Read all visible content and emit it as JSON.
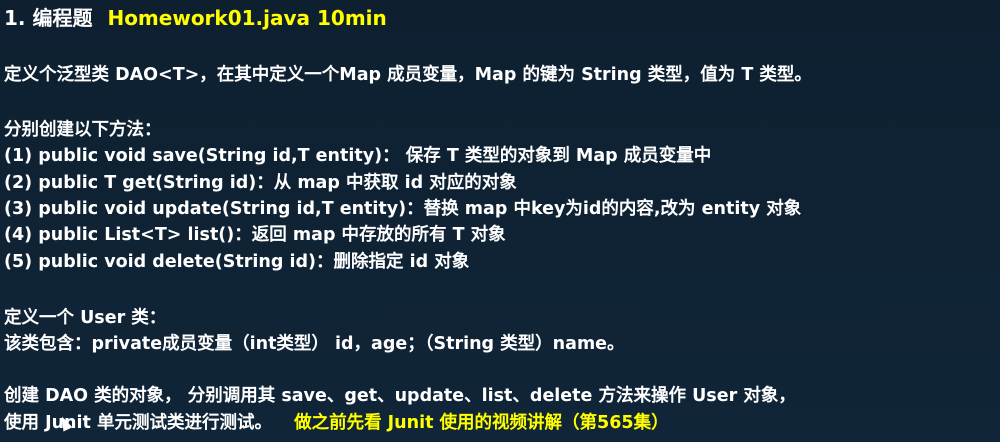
{
  "title": {
    "number": "1. 编程题",
    "file": "Homework01.java  10min"
  },
  "task_intro": "定义个泛型类 DAO<T>，在其中定义一个Map 成员变量，Map 的键为 String 类型，值为 T 类型。",
  "methods_heading": "分别创建以下方法：",
  "methods": [
    "(1) public void save(String id,T entity)： 保存 T 类型的对象到 Map 成员变量中",
    "(2) public T get(String id)：从 map 中获取 id 对应的对象",
    "(3) public void update(String id,T entity)：替换 map 中key为id的内容,改为 entity 对象",
    "(4) public List<T> list()：返回 map 中存放的所有 T 对象",
    "(5) public void delete(String id)：删除指定 id 对象"
  ],
  "user_class": {
    "line1": "定义一个 User 类：",
    "line2": "该类包含：private成员变量（int类型） id，age；（String 类型）name。"
  },
  "closing": {
    "line1": "创建 DAO 类的对象， 分别调用其 save、get、update、list、delete 方法来操作 User 对象，",
    "line2": "使用 Junit 单元测试类进行测试。",
    "note": "做之前先看 Junit 使用的视频讲解（第565集）"
  }
}
